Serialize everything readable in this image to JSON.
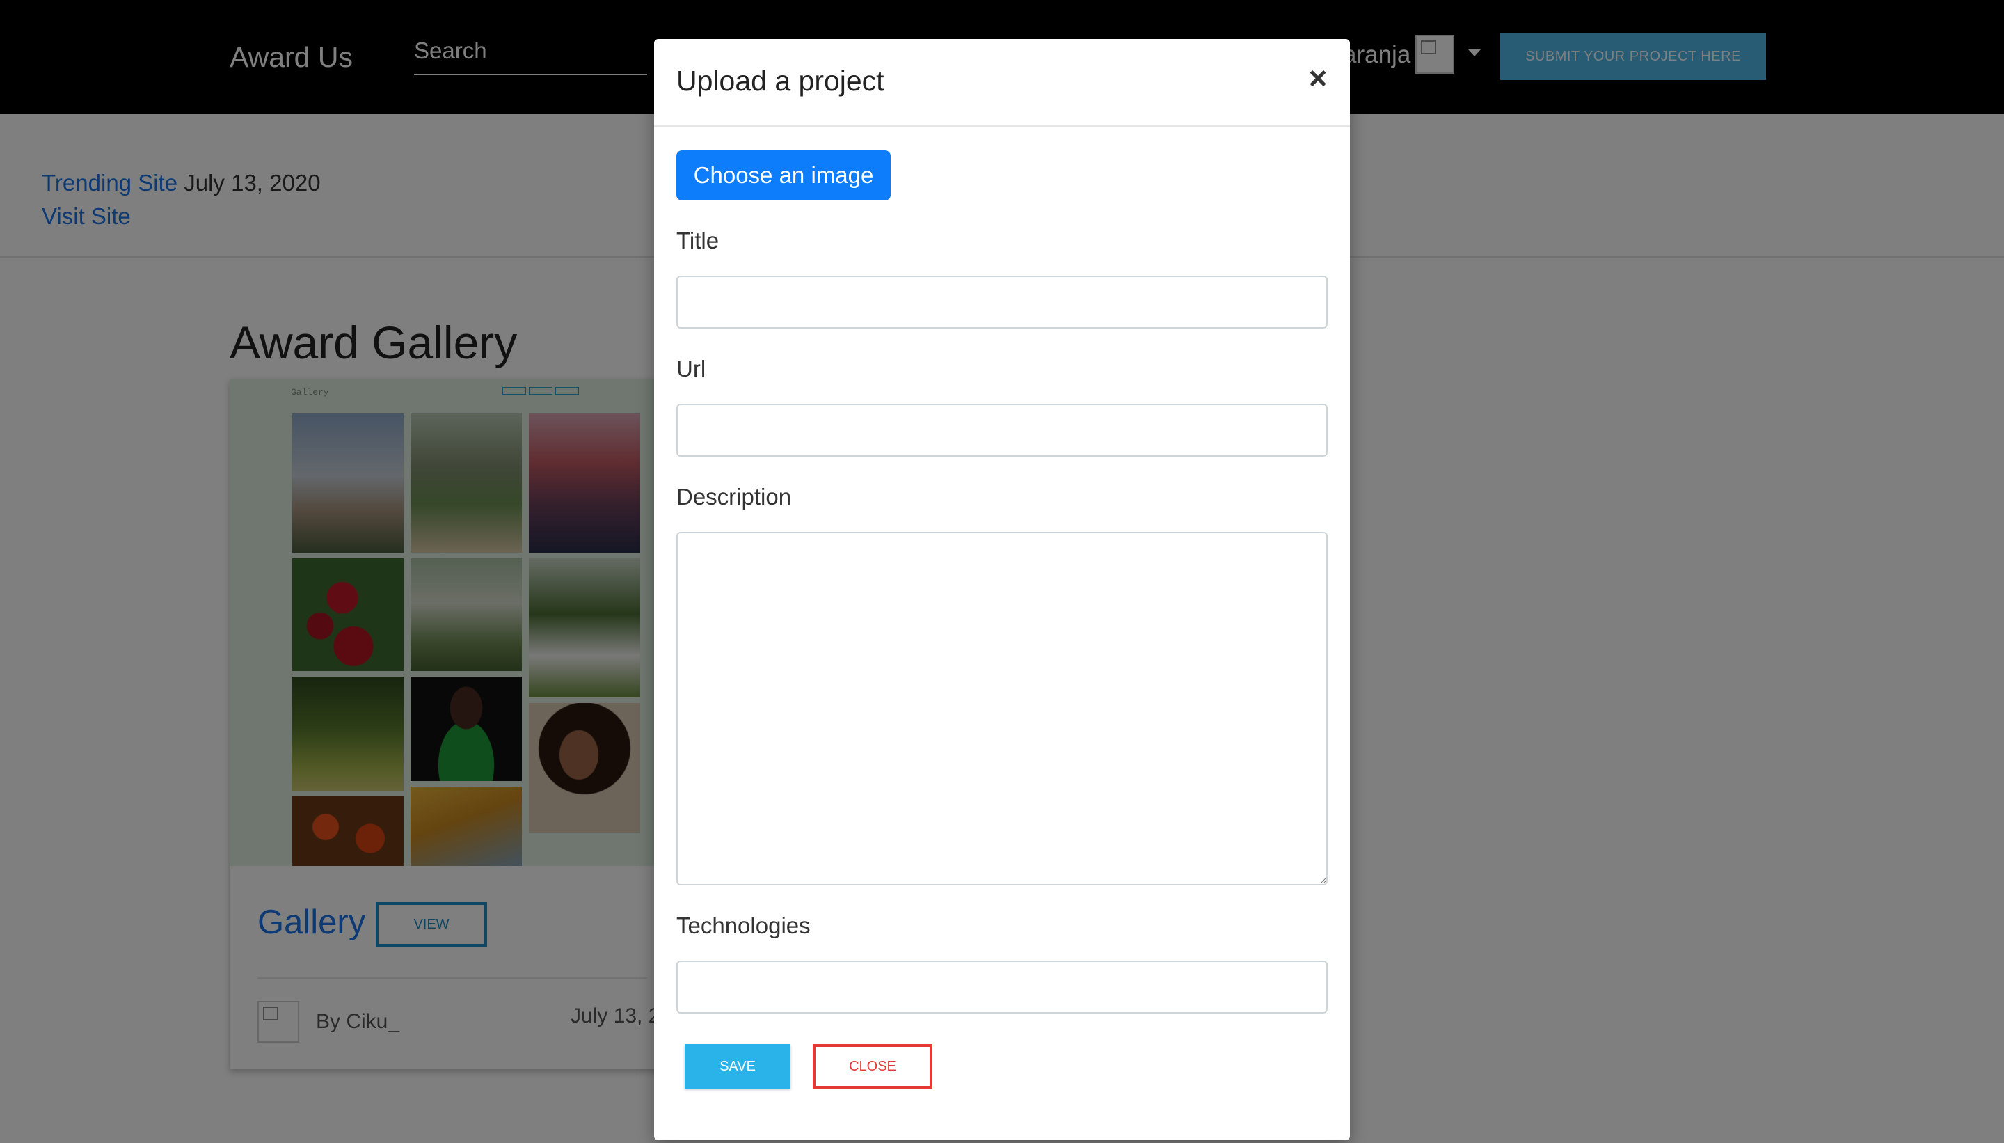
{
  "navbar": {
    "brand": "Award Us",
    "search_placeholder": "Search",
    "username": "aranja",
    "submit_label": "SUBMIT YOUR PROJECT HERE"
  },
  "trending": {
    "label": "Trending Site",
    "date": "July 13, 2020",
    "visit_label": "Visit Site"
  },
  "gallery": {
    "heading": "Award Gallery",
    "card": {
      "thumbnail_title": "Gallery",
      "title": "Gallery",
      "view_label": "VIEW",
      "author": "By Ciku_",
      "date": "July 13, 2"
    }
  },
  "modal": {
    "title": "Upload a project",
    "close_symbol": "×",
    "choose_image_label": "Choose an image",
    "fields": {
      "title_label": "Title",
      "url_label": "Url",
      "description_label": "Description",
      "technologies_label": "Technologies"
    },
    "save_label": "SAVE",
    "close_label": "CLOSE"
  },
  "colors": {
    "navbar_bg": "#000000",
    "primary_blue": "#0d7dfb",
    "link_blue": "#1a73e8",
    "submit_bg": "#4fb8e8",
    "save_bg": "#2ab3e8",
    "close_red": "#e53935"
  }
}
